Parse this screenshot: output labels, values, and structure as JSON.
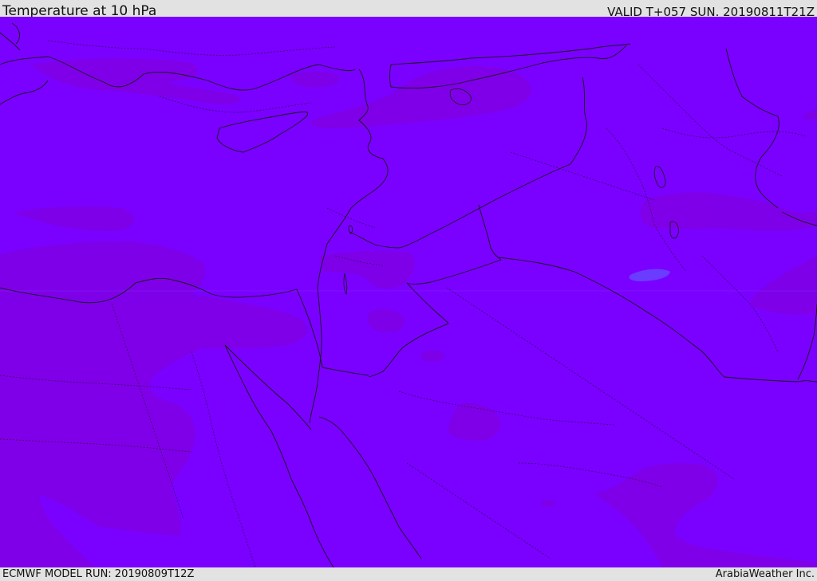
{
  "header": {
    "title": "Temperature at 10 hPa",
    "valid_time": "VALID T+057 SUN. 20190811T21Z"
  },
  "footer": {
    "model_run": "ECMWF MODEL RUN: 20190809T12Z",
    "credit": "ArabiaWeather Inc."
  },
  "map": {
    "base_color": "#7a00ff",
    "darker_band_color": "#7f00e6",
    "blue_patch_color": "#6a3cff",
    "coastline_color": "#1a1a1a",
    "border_style": "dotted"
  }
}
